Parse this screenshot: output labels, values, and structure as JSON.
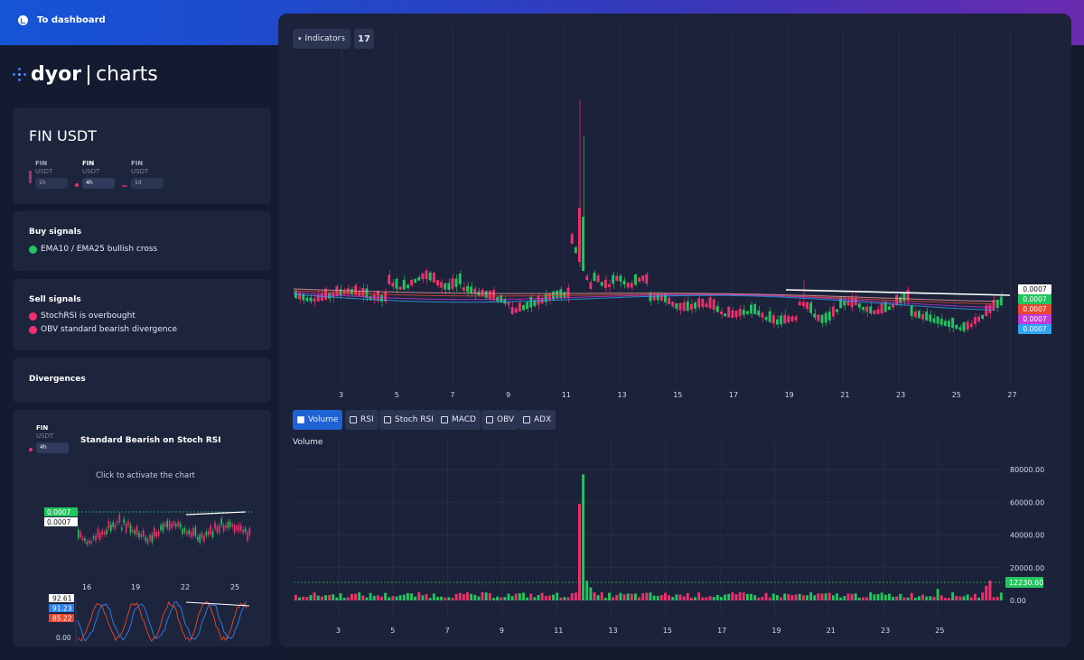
{
  "nav": {
    "back_label": "To dashboard"
  },
  "logo": {
    "part1": "dyor",
    "part2": "charts"
  },
  "pair": {
    "title": "FIN USDT",
    "timeframes": [
      {
        "base": "FIN",
        "quote": "USDT",
        "tf": "1h",
        "active": false
      },
      {
        "base": "FIN",
        "quote": "USDT",
        "tf": "4h",
        "active": true
      },
      {
        "base": "FIN",
        "quote": "USDT",
        "tf": "1d",
        "active": false
      }
    ]
  },
  "buy_signals": {
    "title": "Buy signals",
    "items": [
      "EMA10 / EMA25 bullish cross"
    ]
  },
  "sell_signals": {
    "title": "Sell signals",
    "items": [
      "StochRSI is overbought",
      "OBV standard bearish divergence"
    ]
  },
  "divergences": {
    "title": "Divergences"
  },
  "divergence_card": {
    "base": "FIN",
    "quote": "USDT",
    "tf": "4h",
    "title": "Standard Bearish on Stoch RSI",
    "hint": "Click to activate the chart",
    "mini_x_ticks": [
      "16",
      "19",
      "22",
      "25"
    ],
    "mini_price_tags": [
      "0.0007",
      "0.0007"
    ],
    "stoch_tags": [
      "92.61",
      "91.23",
      "85.22"
    ],
    "stoch_zero": "0.00"
  },
  "toolbar": {
    "indicators_label": "Indicators",
    "tv_logo": "tradingview-icon"
  },
  "price_tags": [
    "0.0007",
    "0.0007",
    "0.0007",
    "0.0007",
    "0.0007"
  ],
  "indicator_tabs": [
    {
      "label": "Volume",
      "active": true
    },
    {
      "label": "RSI",
      "active": false
    },
    {
      "label": "Stoch RSI",
      "active": false
    },
    {
      "label": "MACD",
      "active": false
    },
    {
      "label": "OBV",
      "active": false
    },
    {
      "label": "ADX",
      "active": false
    }
  ],
  "volume": {
    "title": "Volume",
    "current": "12230.60"
  },
  "colors": {
    "up": "#22c55e",
    "down": "#f0306e",
    "panel": "#1b2239",
    "accent": "#1e63d6"
  },
  "chart_data": [
    {
      "type": "candlestick",
      "x_ticks": [
        "3",
        "5",
        "7",
        "9",
        "11",
        "13",
        "15",
        "17",
        "19",
        "21",
        "23",
        "25",
        "27"
      ],
      "last_price": "0.0007",
      "series": [
        {
          "name": "",
          "values": []
        }
      ]
    },
    {
      "type": "bar",
      "title": "Volume",
      "x_ticks": [
        "3",
        "5",
        "7",
        "9",
        "11",
        "13",
        "15",
        "17",
        "19",
        "21",
        "23",
        "25"
      ],
      "y_ticks": [
        "80000.00",
        "60000.00",
        "40000.00",
        "20000.00",
        "0.00"
      ],
      "ylim": [
        0,
        80000
      ],
      "peak_values": [
        59000,
        77000
      ],
      "last_value": 12230.6
    }
  ]
}
